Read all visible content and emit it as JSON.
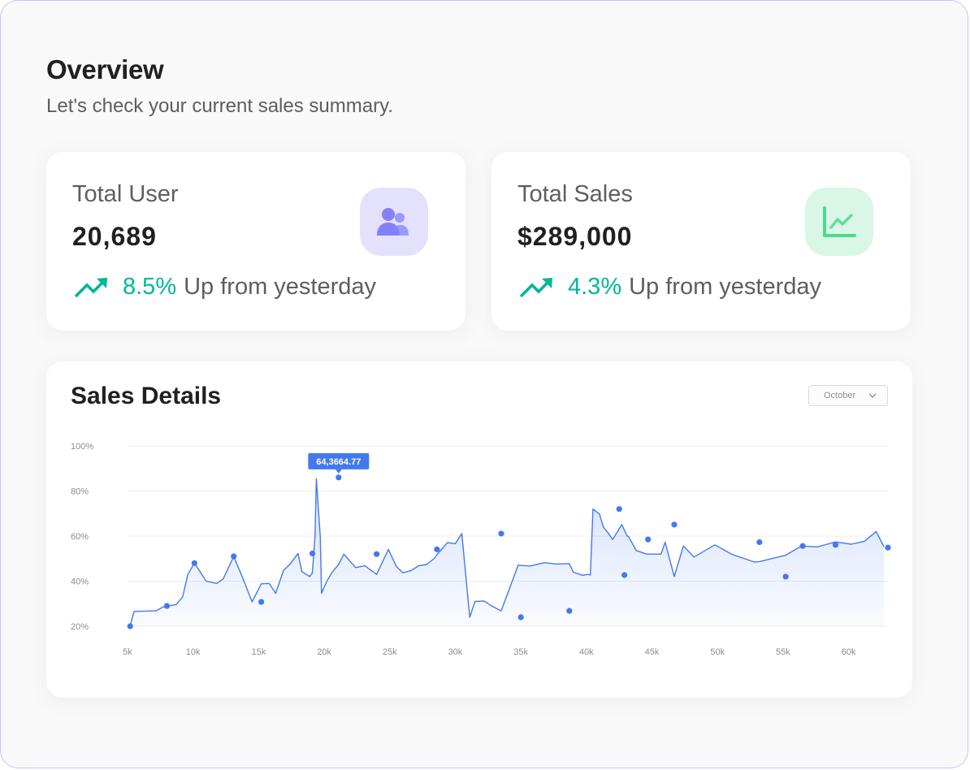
{
  "header": {
    "title": "Overview",
    "subtitle": "Let's check your current sales summary."
  },
  "stats": [
    {
      "label": "Total User",
      "value": "20,689",
      "trend_pct": "8.5%",
      "trend_text": "Up from yesterday",
      "icon": "users-icon",
      "icon_color": "#8280ff",
      "icon_bg": "#e4e1fd"
    },
    {
      "label": "Total Sales",
      "value": "$289,000",
      "trend_pct": "4.3%",
      "trend_text": "Up from yesterday",
      "icon": "line-chart-icon",
      "icon_color": "#4ad991",
      "icon_bg": "#d9f6e6"
    }
  ],
  "colors": {
    "trend": "#00b69b",
    "line": "#4379ee"
  },
  "sales_details": {
    "title": "Sales Details",
    "month_select": "October",
    "tooltip": "64,3664.77"
  },
  "chart_data": {
    "type": "area",
    "xlim": [
      5,
      63
    ],
    "ylim": [
      20,
      100
    ],
    "x_ticks": [
      5,
      10,
      15,
      20,
      25,
      30,
      35,
      40,
      45,
      50,
      55,
      60
    ],
    "x_tick_labels": [
      "5k",
      "10k",
      "15k",
      "20k",
      "25k",
      "30k",
      "35k",
      "40k",
      "45k",
      "50k",
      "55k",
      "60k"
    ],
    "y_ticks": [
      20,
      40,
      60,
      80,
      100
    ],
    "y_tick_labels": [
      "20%",
      "40%",
      "60%",
      "80%",
      "100%"
    ],
    "grid": true,
    "series": [
      {
        "x": [
          5.2,
          5.5,
          6.3,
          7.2,
          7.7,
          8.0,
          8.2,
          8.7,
          9.2,
          9.6,
          10.1,
          11.0,
          11.8,
          12.3,
          13.1,
          13.8,
          14.5,
          15.2,
          15.8,
          16.3,
          16.9,
          17.4,
          18.0,
          18.3,
          18.9,
          19.1,
          19.3,
          19.4,
          19.7,
          19.8,
          20.2,
          20.6,
          21.1,
          21.5,
          21.8,
          22.4,
          23.1,
          24.0,
          24.9,
          25.5,
          26.0,
          26.6,
          27.2,
          27.8,
          28.4,
          28.6,
          29.4,
          30.0,
          30.5,
          31.1,
          31.5,
          32.2,
          32.8,
          33.5,
          34.8,
          35.7,
          36.8,
          37.7,
          38.7,
          39.0,
          39.7,
          40.1,
          40.3,
          40.5,
          41.0,
          41.3,
          41.7,
          42.0,
          42.7,
          43.1,
          43.2,
          43.8,
          44.6,
          45.1,
          45.7,
          46.0,
          46.7,
          47.4,
          48.2,
          49.8,
          51.1,
          52.8,
          53.2,
          55.2,
          56.4,
          57.6,
          59.0,
          60.2,
          61.2,
          62.1,
          62.7
        ],
        "y": [
          20.3,
          26.6,
          26.7,
          26.9,
          28.5,
          28.9,
          29.1,
          29.6,
          33.0,
          43.0,
          48.0,
          40.0,
          39.0,
          41.0,
          51.0,
          41.2,
          30.8,
          38.8,
          39.0,
          34.6,
          44.8,
          47.6,
          52.3,
          44.2,
          42.0,
          43.7,
          60.0,
          85.4,
          60.0,
          34.6,
          40.0,
          43.9,
          47.4,
          52.0,
          50.0,
          46.0,
          46.8,
          43.0,
          54.1,
          46.6,
          43.7,
          44.6,
          46.8,
          47.4,
          50.1,
          51.7,
          57.1,
          56.6,
          61.1,
          24.0,
          31.0,
          31.2,
          28.9,
          26.8,
          47.1,
          46.7,
          48.2,
          47.6,
          47.8,
          44.0,
          42.6,
          43.0,
          42.7,
          72.0,
          69.7,
          64.0,
          61.0,
          58.5,
          65.1,
          60.0,
          59.9,
          53.6,
          52.0,
          52.0,
          52.0,
          57.3,
          42.0,
          55.6,
          50.7,
          56.1,
          51.9,
          48.5,
          48.7,
          51.5,
          55.6,
          55.2,
          57.4,
          56.4,
          57.7,
          62.0,
          55.2
        ]
      }
    ],
    "markers": [
      {
        "x": 5.2,
        "y": 20.0
      },
      {
        "x": 10.1,
        "y": 48.0
      },
      {
        "x": 8.0,
        "y": 29.0
      },
      {
        "x": 13.1,
        "y": 51.0
      },
      {
        "x": 15.2,
        "y": 30.8
      },
      {
        "x": 19.1,
        "y": 52.3
      },
      {
        "x": 21.1,
        "y": 86.0
      },
      {
        "x": 24.0,
        "y": 52.0
      },
      {
        "x": 28.6,
        "y": 54.1
      },
      {
        "x": 33.5,
        "y": 61.1
      },
      {
        "x": 35.0,
        "y": 24.0
      },
      {
        "x": 38.7,
        "y": 26.8
      },
      {
        "x": 42.5,
        "y": 72.0
      },
      {
        "x": 42.9,
        "y": 42.7
      },
      {
        "x": 44.7,
        "y": 58.5
      },
      {
        "x": 46.7,
        "y": 65.1
      },
      {
        "x": 53.2,
        "y": 57.3
      },
      {
        "x": 55.2,
        "y": 42.0
      },
      {
        "x": 56.5,
        "y": 55.6
      },
      {
        "x": 59.0,
        "y": 56.1
      },
      {
        "x": 63.0,
        "y": 54.9
      }
    ],
    "highlight": {
      "x": 21.1,
      "y": 86.0
    }
  }
}
